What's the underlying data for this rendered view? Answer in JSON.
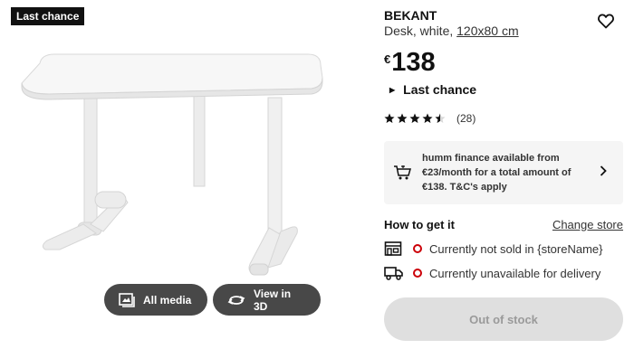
{
  "badge": {
    "label": "Last chance"
  },
  "media_buttons": {
    "all_media": "All media",
    "view_3d": "View in 3D"
  },
  "product": {
    "name": "BEKANT",
    "description": "Desk, white, ",
    "measurement": "120x80 cm",
    "currency": "€",
    "price": "138",
    "status_label": "Last chance",
    "rating_value": 4.5,
    "rating_count": "(28)"
  },
  "finance": {
    "text": "humm finance available from €23/month for a total amount of €138. T&C's apply",
    "icon": "cart-finance-icon"
  },
  "delivery": {
    "heading": "How to get it",
    "change_store": "Change store",
    "store_status": "Currently not sold in {storeName}",
    "delivery_status": "Currently unavailable for delivery"
  },
  "actions": {
    "out_of_stock": "Out of stock"
  },
  "colors": {
    "status_red": "#cc0008",
    "dark_button": "#484848",
    "disabled_bg": "#dfdfdf"
  }
}
